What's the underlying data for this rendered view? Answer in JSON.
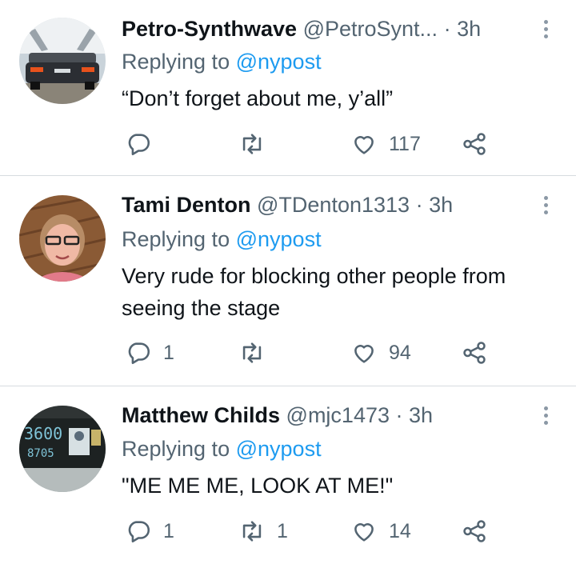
{
  "tweets": [
    {
      "name": "Petro-Synthwave",
      "handle": "@PetroSynt...",
      "dot": "·",
      "time": "3h",
      "replying_prefix": "Replying to",
      "replying_mention": "@nypost",
      "text": "“Don’t forget about me, y’all”",
      "reply_count": "",
      "retweet_count": "",
      "like_count": "117"
    },
    {
      "name": "Tami Denton",
      "handle": "@TDenton1313",
      "dot": "·",
      "time": "3h",
      "replying_prefix": "Replying to",
      "replying_mention": "@nypost",
      "text": "Very rude for blocking other people from seeing the stage",
      "reply_count": "1",
      "retweet_count": "",
      "like_count": "94"
    },
    {
      "name": "Matthew Childs",
      "handle": "@mjc1473",
      "dot": "·",
      "time": "3h",
      "replying_prefix": "Replying to",
      "replying_mention": "@nypost",
      "text": "\"ME ME ME, LOOK AT ME!\"",
      "reply_count": "1",
      "retweet_count": "1",
      "like_count": "14"
    }
  ],
  "colors": {
    "text": "#0f1419",
    "muted": "#536471",
    "mention": "#1d9bf0",
    "divider": "#d6dbdf"
  },
  "icons": [
    "reply-icon",
    "retweet-icon",
    "like-icon",
    "share-icon",
    "more-icon"
  ],
  "avatar_text": {
    "clock_top": "3600",
    "clock_bottom": "8705"
  }
}
